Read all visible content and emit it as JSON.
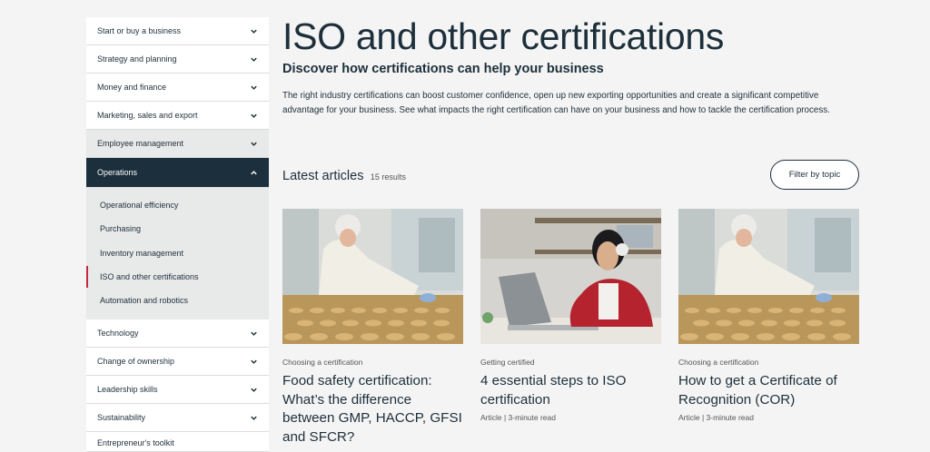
{
  "sidebar": {
    "items_top": [
      {
        "label": "Start or buy a business"
      },
      {
        "label": "Strategy and planning"
      },
      {
        "label": "Money and finance"
      },
      {
        "label": "Marketing, sales and export"
      },
      {
        "label": "Employee management"
      }
    ],
    "active": {
      "label": "Operations"
    },
    "sub_items": [
      {
        "label": "Operational efficiency"
      },
      {
        "label": "Purchasing"
      },
      {
        "label": "Inventory management"
      },
      {
        "label": "ISO and other certifications"
      },
      {
        "label": "Automation and robotics"
      }
    ],
    "items_bottom": [
      {
        "label": "Technology"
      },
      {
        "label": "Change of ownership"
      },
      {
        "label": "Leadership skills"
      },
      {
        "label": "Sustainability"
      },
      {
        "label": "Entrepreneur's toolkit"
      }
    ]
  },
  "page": {
    "title": "ISO and other certifications",
    "subtitle": "Discover how certifications can help your business",
    "intro": "The right industry certifications can boost customer confidence, open up new exporting opportunities and create a significant competitive advantage for your business. See what impacts the right certification can have on your business and how to tackle the certification process."
  },
  "latest": {
    "title": "Latest articles",
    "count": "15 results",
    "filter_label": "Filter by topic"
  },
  "cards": [
    {
      "category": "Choosing a certification",
      "title": "Food safety certification: What’s the difference between GMP, HACCP, GFSI and SFCR?",
      "meta": ""
    },
    {
      "category": "Getting certified",
      "title": "4 essential steps to ISO certification",
      "meta": "Article | 3-minute read"
    },
    {
      "category": "Choosing a certification",
      "title": "How to get a Certificate of Recognition (COR)",
      "meta": "Article | 3-minute read"
    }
  ],
  "colors": {
    "navy": "#1b2f3c",
    "accent_red": "#c5283d",
    "background": "#f4f4f4"
  }
}
